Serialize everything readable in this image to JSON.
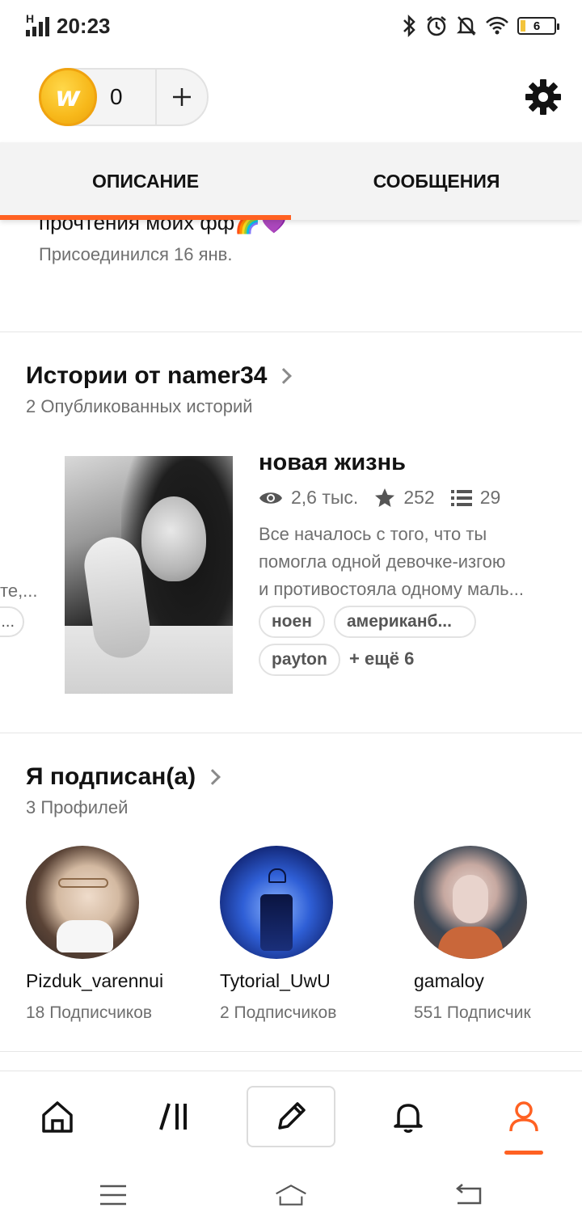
{
  "status": {
    "network": "H",
    "time": "20:23",
    "battery": "6",
    "battery_level": 0.06
  },
  "wallet": {
    "coins": "0",
    "coin_letter": "w",
    "add_icon": "plus-icon",
    "settings_icon": "gear-icon"
  },
  "tabs": [
    {
      "label": "ОПИСАНИЕ",
      "active": true
    },
    {
      "label": "СООБЩЕНИЯ",
      "active": false
    }
  ],
  "bio": {
    "line": "прочтения моих фф🌈💜",
    "joined": "Присоединился 16 янв."
  },
  "stories": {
    "title": "Истории от namer34",
    "subtitle": "2 Опубликованных историй",
    "partial_text": "те,...",
    "partial_tag": "...",
    "card": {
      "title": "новая жизнь",
      "reads": "2,6 тыс.",
      "votes": "252",
      "parts": "29",
      "description": [
        "Все началось с того, что ты",
        "помогла одной девочке-изгою",
        "и противостояла одному маль..."
      ],
      "tags": [
        "ноен",
        "американб...",
        "payton"
      ],
      "more_tags": "+ ещё 6"
    }
  },
  "following": {
    "title": "Я подписан(а)",
    "subtitle": "3 Профилей",
    "profiles": [
      {
        "name": "Pizduk_varennui",
        "followers": "18 Подписчиков"
      },
      {
        "name": "Tytorial_UwU",
        "followers": "2 Подписчиков"
      },
      {
        "name": "gamaloy",
        "followers": "551 Подписчик"
      }
    ]
  },
  "nav": {
    "items": [
      "home-icon",
      "library-icon",
      "write-icon",
      "bell-icon",
      "profile-icon"
    ],
    "active_color": "#ff6122"
  },
  "colors": {
    "accent": "#ff6122",
    "coin": "#f7b81a"
  }
}
